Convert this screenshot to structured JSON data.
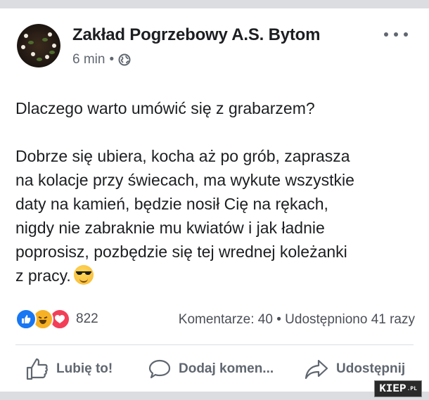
{
  "post": {
    "author": "Zakład Pogrzebowy A.S. Bytom",
    "time": "6 min",
    "separator": "•",
    "privacy_icon": "globe-icon",
    "more_icon": "more-options-icon"
  },
  "content": {
    "line1": "Dlaczego warto umówić się z grabarzem?",
    "paragraph": [
      "Dobrze się ubiera, kocha aż po grób, zaprasza",
      "na kolacje przy świecach, ma wykute wszystkie",
      "daty na kamień, będzie nosił Cię na rękach,",
      "nigdy nie zabraknie mu kwiatów i jak ładnie",
      "poprosisz, pozbędzie się tej wrednej koleżanki",
      "z pracy."
    ],
    "emoji": "sunglasses-emoji"
  },
  "engagement": {
    "reaction_icons": [
      "like-reaction-icon",
      "haha-reaction-icon",
      "love-reaction-icon"
    ],
    "reaction_count": "822",
    "comments": "Komentarze: 40",
    "dot": "•",
    "shares": "Udostępniono 41 razy"
  },
  "actions": {
    "like": "Lubię to!",
    "comment": "Dodaj komen...",
    "share": "Udostępnij"
  },
  "watermark": {
    "text": "KIEP",
    "suffix": ".PL"
  },
  "colors": {
    "facebook_blue": "#1877f2",
    "text": "#1c1e21",
    "secondary_text": "#606770",
    "love_red": "#f33e58",
    "haha_yellow": "#f7b125"
  }
}
